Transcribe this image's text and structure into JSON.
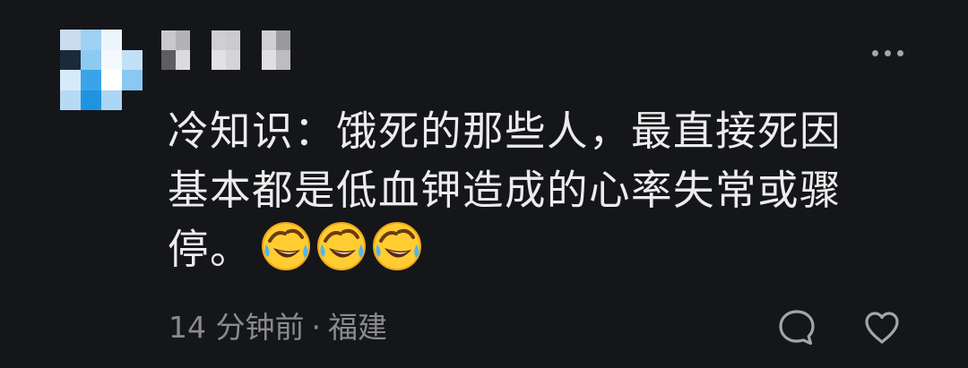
{
  "comment": {
    "text_line_1": "冷知识：饿死的那些人，最直接死因",
    "text_line_2": "基本都是低血钾造成的心率失常或骤",
    "text_line_3": "停。",
    "emojis": [
      "rolling-on-floor-laughing-emoji",
      "rolling-on-floor-laughing-emoji",
      "rolling-on-floor-laughing-emoji"
    ],
    "time_ago": "14 分钟前",
    "separator": "·",
    "location": "福建"
  },
  "icons": {
    "more": "more-horizontal-icon",
    "reply": "comment-bubble-icon",
    "like": "heart-outline-icon"
  },
  "colors": {
    "background": "#151619",
    "text": "#ececed",
    "meta_text": "#8a8b90",
    "icon": "#a4a5aa"
  }
}
